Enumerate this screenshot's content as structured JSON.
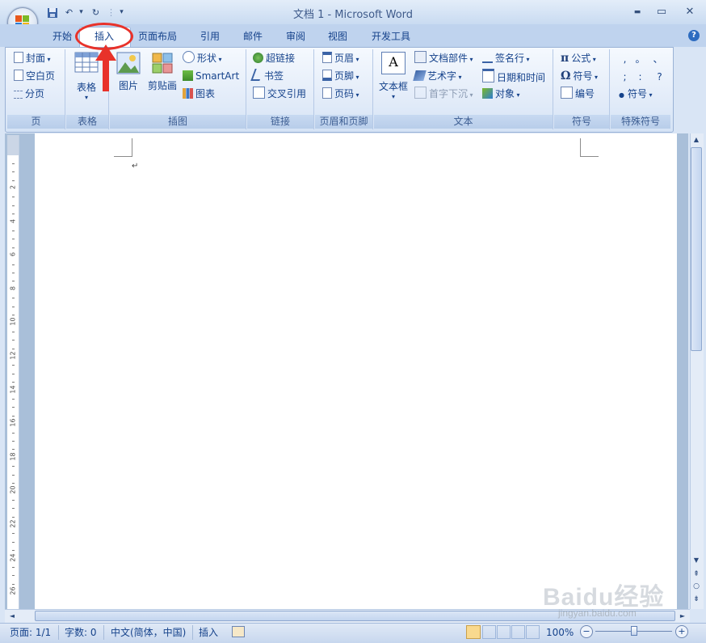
{
  "window": {
    "title": "文档 1 - Microsoft Word",
    "min_glyph": "▬",
    "max_glyph": "▭",
    "close_glyph": "✕"
  },
  "qat": {
    "save": "💾",
    "undo": "↶",
    "redo": "↻",
    "dropdown": "▾",
    "sep": "⋮"
  },
  "tabs": [
    "开始",
    "插入",
    "页面布局",
    "引用",
    "邮件",
    "审阅",
    "视图",
    "开发工具"
  ],
  "active_tab": "插入",
  "help_glyph": "?",
  "ribbon": {
    "groups": {
      "page": "页",
      "table": "表格",
      "illustrations": "插图",
      "links": "链接",
      "header_footer": "页眉和页脚",
      "text": "文本",
      "symbols": "符号",
      "special": "特殊符号"
    },
    "page": {
      "cover": "封面",
      "blank": "空白页",
      "break": "分页"
    },
    "table": {
      "table": "表格"
    },
    "illustrations": {
      "picture": "图片",
      "clipart": "剪贴画",
      "shapes": "形状",
      "smartart": "SmartArt",
      "chart": "图表"
    },
    "links": {
      "hyperlink": "超链接",
      "bookmark": "书签",
      "crossref": "交叉引用"
    },
    "header_footer": {
      "header": "页眉",
      "footer": "页脚",
      "page_number": "页码"
    },
    "text": {
      "textbox": "文本框",
      "quick_parts": "文档部件",
      "wordart": "艺术字",
      "dropcap": "首字下沉",
      "signature": "签名行",
      "datetime": "日期和时间",
      "object": "对象"
    },
    "symbols": {
      "equation": "公式",
      "symbol": "符号",
      "number": "编号",
      "pi": "π",
      "omega": "Ω"
    },
    "special": {
      "row1": [
        ",",
        "。",
        "、"
      ],
      "row2": [
        ";",
        ":",
        "?"
      ],
      "symbol": "符号",
      "bullet": "●"
    }
  },
  "ruler_numbers": [
    "2",
    "4",
    "6",
    "8",
    "10",
    "12",
    "14",
    "16",
    "18",
    "20",
    "22",
    "24",
    "26"
  ],
  "document": {
    "paragraph_mark": "↵"
  },
  "statusbar": {
    "page": "页面: 1/1",
    "words": "字数: 0",
    "language": "中文(简体，中国)",
    "mode": "插入",
    "zoom": "100%",
    "zoom_minus": "−",
    "zoom_plus": "+",
    "zoom_value": 100
  },
  "scroll": {
    "up": "▲",
    "down": "▼",
    "left": "◄",
    "right": "►",
    "prev": "⇞",
    "select": "○",
    "next": "⇟"
  },
  "watermark": {
    "main": "Baidu经验",
    "sub": "jingyan.baidu.com"
  },
  "colors": {
    "accent": "#15428b",
    "annotation": "#e8322a",
    "ribbon_bg": "#dfe9f7"
  }
}
